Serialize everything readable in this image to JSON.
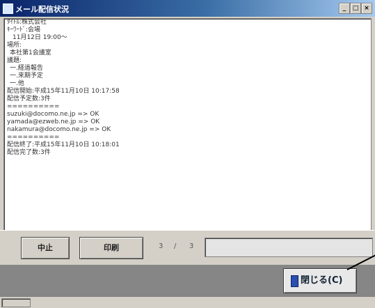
{
  "window": {
    "title": "メール配信状況",
    "controls": [
      "_",
      "□",
      "×"
    ]
  },
  "log": {
    "lines": [
      "ﾀｲﾄﾙ:株式会社",
      "ｷｰﾜｰﾄﾞ:会場",
      "11月12日  19:00〜",
      "場所:",
      "本社第1会議室",
      "議題:",
      "一.経過報告",
      "一.来期予定",
      "一.他",
      "配信開始:平成15年11月10日  10:17:58",
      "配信予定数:3件",
      "==========",
      "suzuki@docomo.ne.jp => OK",
      "yamada@ezweb.ne.jp => OK",
      "nakamura@docomo.ne.jp => OK",
      "==========",
      "配信終了:平成15年11月10日  10:18:01",
      "配信完了数:3件"
    ]
  },
  "toolbar": {
    "stop_label": "中止",
    "print_label": "印刷",
    "progress_current": "3",
    "progress_separator": "/",
    "progress_total": "3",
    "progress_fraction": 1.0
  },
  "footer": {
    "close_label": "閉じる(C)"
  },
  "colors": {
    "titlebar_start": "#0a246a",
    "titlebar_end": "#a6caf0",
    "face": "#d4d0c8",
    "bottom_bar": "#868686"
  }
}
